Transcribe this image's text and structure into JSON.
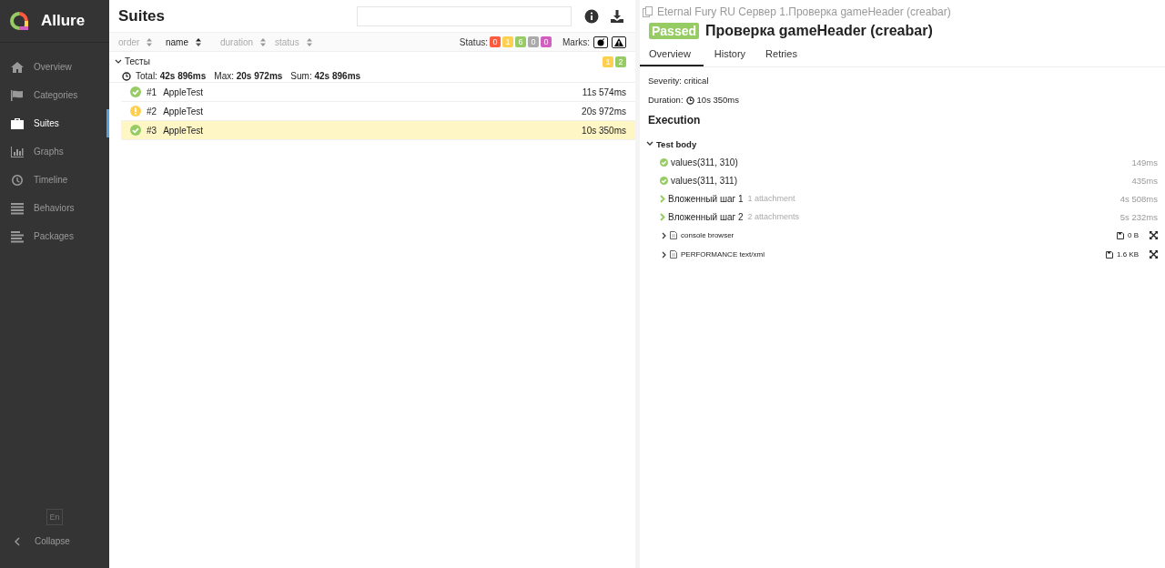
{
  "sidebar": {
    "brand": "Allure",
    "items": [
      {
        "label": "Overview",
        "kind": "home",
        "selected": false
      },
      {
        "label": "Categories",
        "kind": "flag",
        "selected": false
      },
      {
        "label": "Suites",
        "kind": "briefcase",
        "selected": true
      },
      {
        "label": "Graphs",
        "kind": "chart",
        "selected": false
      },
      {
        "label": "Timeline",
        "kind": "clock",
        "selected": false
      },
      {
        "label": "Behaviors",
        "kind": "list",
        "selected": false
      },
      {
        "label": "Packages",
        "kind": "lines",
        "selected": false
      }
    ],
    "language": "En",
    "collapse": "Collapse"
  },
  "suites": {
    "title": "Suites",
    "sort_columns": [
      {
        "label": "order",
        "selected": false
      },
      {
        "label": "name",
        "selected": true
      },
      {
        "label": "duration",
        "selected": false
      },
      {
        "label": "status",
        "selected": false
      }
    ],
    "status_label": "Status:",
    "status_counts": [
      {
        "value": "0",
        "color": "#fd5a3e"
      },
      {
        "value": "1",
        "color": "#ffd050"
      },
      {
        "value": "6",
        "color": "#97cc64"
      },
      {
        "value": "0",
        "color": "#aaaaaa"
      },
      {
        "value": "0",
        "color": "#d35ebe"
      }
    ],
    "marks_label": "Marks:",
    "group": {
      "name": "Тесты",
      "expanded": true,
      "counts": [
        {
          "value": "1",
          "color": "#ffd050"
        },
        {
          "value": "2",
          "color": "#97cc64"
        }
      ],
      "stats": [
        {
          "label": "Total:",
          "value": "42s 896ms"
        },
        {
          "label": "Max:",
          "value": "20s 972ms"
        },
        {
          "label": "Sum:",
          "value": "42s 896ms"
        }
      ],
      "rows": [
        {
          "number": "#1",
          "name": "AppleTest",
          "duration": "11s 574ms",
          "kind": "passed",
          "selected": false
        },
        {
          "number": "#2",
          "name": "AppleTest",
          "duration": "20s 972ms",
          "kind": "broken",
          "selected": false
        },
        {
          "number": "#3",
          "name": "AppleTest",
          "duration": "10s 350ms",
          "kind": "passed",
          "selected": true
        }
      ]
    }
  },
  "detail": {
    "breadcrumb": "Eternal Fury RU Сервер 1.Проверка gameHeader (creabar)",
    "status": "Passed",
    "title": "Проверка gameHeader (creabar)",
    "tabs": [
      {
        "label": "Overview",
        "selected": true
      },
      {
        "label": "History",
        "selected": false
      },
      {
        "label": "Retries",
        "selected": false
      }
    ],
    "severity": "Severity: critical",
    "duration_label": "Duration:",
    "duration": "10s 350ms",
    "execution": "Execution",
    "body": {
      "label": "Test body",
      "expanded": true
    },
    "steps": [
      {
        "kind": "step",
        "name": "values(311, 310)",
        "duration": "149ms"
      },
      {
        "kind": "step",
        "name": "values(311, 311)",
        "duration": "435ms"
      },
      {
        "kind": "nested",
        "name": "Вложенный шаг 1",
        "note": "1 attachment",
        "duration": "4s 508ms"
      },
      {
        "kind": "nested",
        "name": "Вложенный шаг 2",
        "note": "2 attachments",
        "duration": "5s 232ms"
      },
      {
        "kind": "attachment",
        "name": "console browser",
        "size": "0 B"
      },
      {
        "kind": "attachment",
        "name": "PERFORMANCE text/xml",
        "size": "1.6 KB"
      }
    ]
  }
}
